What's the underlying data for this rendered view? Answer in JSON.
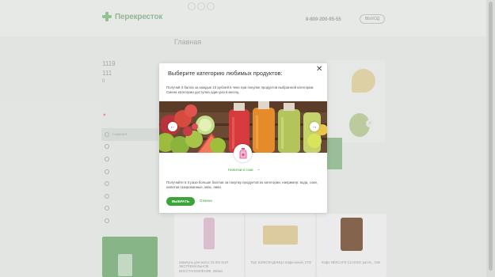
{
  "header": {
    "logo_text": "Перекресток",
    "logo_subtitle": "",
    "phone": "8-800-200-95-55",
    "exit_label": "ВЫХОД"
  },
  "sidebar": {
    "points": "1119",
    "rubles": "111",
    "zero": "0",
    "favorites_label": "",
    "nav": [
      {
        "label": "ГЛАВНАЯ",
        "icon": "home-icon",
        "active": true
      },
      {
        "label": "",
        "icon": "list-icon"
      },
      {
        "label": "",
        "icon": "chart-icon"
      },
      {
        "label": "",
        "icon": "tag-icon"
      },
      {
        "label": "",
        "icon": "card-icon"
      },
      {
        "label": "",
        "icon": "gift-icon"
      },
      {
        "label": "",
        "icon": "question-icon"
      },
      {
        "label": "",
        "icon": "settings-icon"
      }
    ],
    "promo_title": ""
  },
  "main": {
    "page_title": "Главная"
  },
  "products": [
    {
      "name": "Шампунь для волос GLISS KUR ЭКСТРЕМАЛЬНОЕ ВОССТАНОВЛЕНИЕ, 250мл"
    },
    {
      "name": "Торт ШОКОЛАДНИЦА вафельный, 270г"
    },
    {
      "name": "Кофе NESCAFE CLASSIC раств., 150г"
    }
  ],
  "modal": {
    "title": "Выберите категорию любимых продуктов:",
    "description": "Получай 3 балла за каждые 10 рублей в чеке при покупке продуктов выбранной категории. Смена категории доступна один раз в месяц.",
    "category_label": "Напитки и соки",
    "body_text": "Получайте в 3 раза больше баллов за покупку продуктов из категории, например: вода, соки, напитки газированные, квас, пиво",
    "choose_label": "ВЫБРАТЬ",
    "cancel_label": "Отмена",
    "close_glyph": "✕",
    "prev_glyph": "←",
    "next_glyph": "→",
    "chevron_glyph": "⌄"
  },
  "colors": {
    "brand_green": "#3da43b",
    "link_green": "#3aa03a"
  }
}
